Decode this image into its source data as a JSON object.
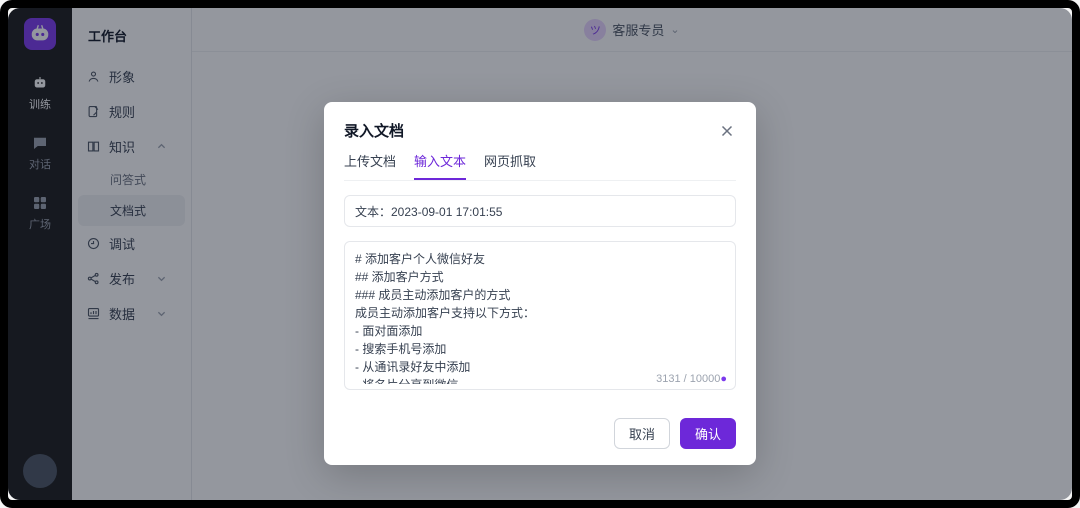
{
  "leftbar": {
    "items": [
      {
        "label": "训练"
      },
      {
        "label": "对话"
      },
      {
        "label": "广场"
      }
    ]
  },
  "sidebar": {
    "title": "工作台",
    "items": [
      {
        "label": "形象"
      },
      {
        "label": "规则"
      },
      {
        "label": "知识",
        "sub": [
          {
            "label": "问答式"
          },
          {
            "label": "文档式"
          }
        ]
      },
      {
        "label": "调试"
      },
      {
        "label": "发布"
      },
      {
        "label": "数据"
      }
    ]
  },
  "header": {
    "avatar_char": "ツ",
    "title": "客服专员"
  },
  "modal": {
    "title": "录入文档",
    "tabs": [
      {
        "label": "上传文档"
      },
      {
        "label": "输入文本"
      },
      {
        "label": "网页抓取"
      }
    ],
    "title_input_value": "文本：2023-09-01 17:01:55",
    "content_value": "# 添加客户个人微信好友\n## 添加客户方式\n### 成员主动添加客户的方式\n成员主动添加客户支持以下方式：\n- 面对面添加\n- 搜索手机号添加\n- 从通讯录好友中添加\n- 将名片分享到微信\n- 互通群中点击群成员好友详情发起添加\n- 通过好友名片添加",
    "counter_current": "3131",
    "counter_sep": " / ",
    "counter_max": "10000",
    "cancel_label": "取消",
    "confirm_label": "确认"
  }
}
